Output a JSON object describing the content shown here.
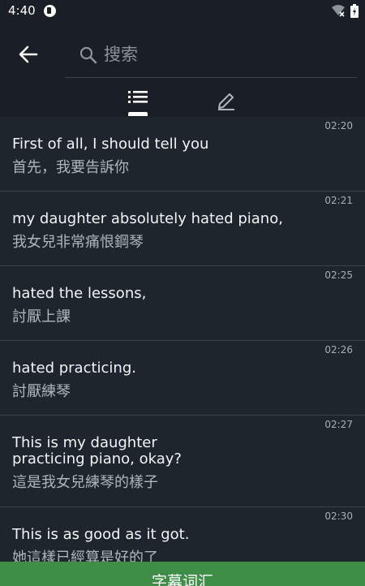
{
  "status_bar": {
    "time": "4:40"
  },
  "search": {
    "placeholder": "搜索"
  },
  "tabs": [
    {
      "icon": "list-icon",
      "selected": true
    },
    {
      "icon": "pencil-icon",
      "selected": false
    }
  ],
  "subtitles": [
    {
      "time": "02:20",
      "en": "First of all, I should tell you",
      "zh": "首先，我要告訴你"
    },
    {
      "time": "02:21",
      "en": "my daughter absolutely hated piano,",
      "zh": "我女兒非常痛恨鋼琴"
    },
    {
      "time": "02:25",
      "en": "hated the lessons,",
      "zh": "討厭上課"
    },
    {
      "time": "02:26",
      "en": "hated practicing.",
      "zh": "討厭練琴"
    },
    {
      "time": "02:27",
      "en_line1": "This is my daughter",
      "en_line2": "practicing piano, okay?",
      "zh": "這是我女兒練琴的樣子"
    },
    {
      "time": "02:30",
      "en": "This is as good as it got.",
      "zh": "她這樣已經算是好的了"
    }
  ],
  "bottom_button": {
    "label": "字幕词汇"
  },
  "colors": {
    "background": "#1f252d",
    "appbar": "#1a1f26",
    "accent_green": "#3e8e47",
    "divider": "#3a424c"
  }
}
